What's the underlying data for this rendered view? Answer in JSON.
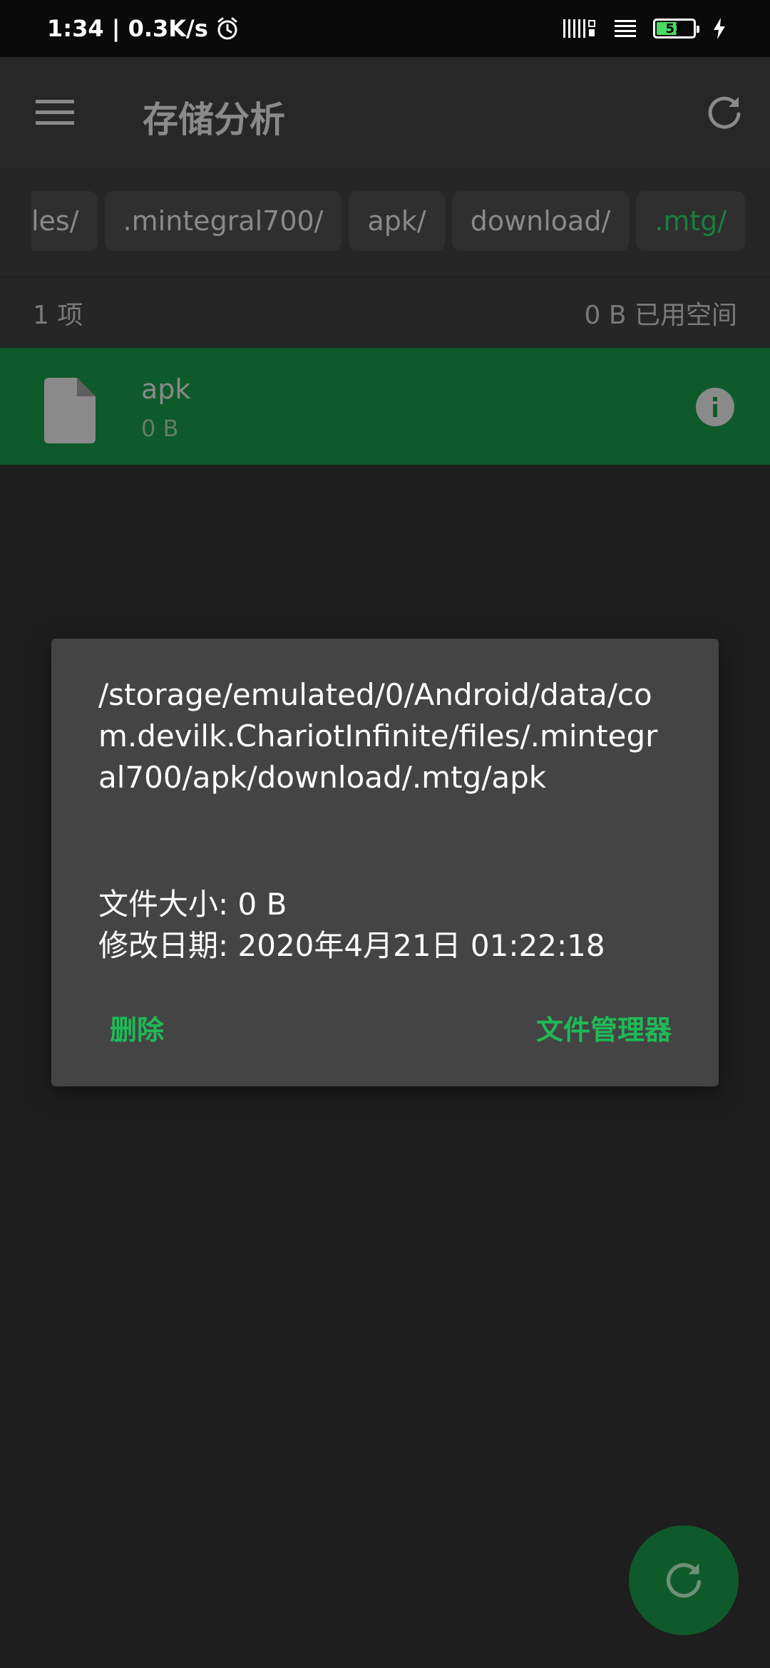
{
  "status_bar": {
    "time": "1:34 | 0.3K/s",
    "battery_level": "51",
    "icons": [
      "alarm-icon",
      "signal-icon",
      "wifi-lines-icon",
      "battery-icon",
      "charge-icon"
    ]
  },
  "toolbar": {
    "title": "存储分析",
    "icons": [
      "menu-icon",
      "refresh-icon"
    ]
  },
  "breadcrumbs": [
    "les/",
    ".mintegral700/",
    "apk/",
    "download/",
    ".mtg/"
  ],
  "summary": {
    "count": "1 项",
    "used_space": "0 B 已用空间"
  },
  "files": [
    {
      "name": "apk",
      "size": "0 B"
    }
  ],
  "dialog": {
    "path": "/storage/emulated/0/Android/data/com.devilk.ChariotInfinite/files/.mintegral700/apk/download/.mtg/apk",
    "size_line": "文件大小: 0 B",
    "date_line": "修改日期: 2020年4月21日 01:22:18",
    "delete_label": "删除",
    "file_manager_label": "文件管理器"
  },
  "colors": {
    "accent": "#1fba57",
    "selected_row": "#0f5a2a",
    "dialog_bg": "#444444"
  }
}
